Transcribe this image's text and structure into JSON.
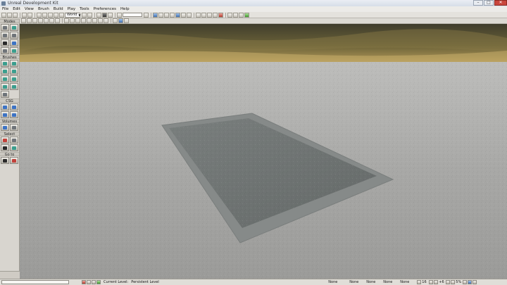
{
  "window": {
    "title": "Unreal Development Kit",
    "controls": {
      "minimize": "–",
      "maximize": "□",
      "close": "✕"
    }
  },
  "menubar": {
    "items": [
      "File",
      "Edit",
      "View",
      "Brush",
      "Build",
      "Play",
      "Tools",
      "Preferences",
      "Help"
    ]
  },
  "toolbar": {
    "coordinate_system": "World"
  },
  "modes_panel": {
    "sections": [
      "Modes",
      "Brushes",
      "CSG",
      "Volumes",
      "Select",
      "Go to"
    ]
  },
  "statusbar": {
    "current_level_label": "Current Level:",
    "current_level_value": "Persistent Level",
    "none_fields": [
      "None",
      "None",
      "None",
      "None",
      "None"
    ],
    "grid_size": "16",
    "rotation_snap": "+6",
    "scale_snap": "5%"
  },
  "viewport": {
    "sky_top": "#3f3d2c",
    "sky_glow": "#b49a5a",
    "ground": "#a3a3a1",
    "slab_top": "#6f7473",
    "slab_edge": "#8c908f"
  }
}
